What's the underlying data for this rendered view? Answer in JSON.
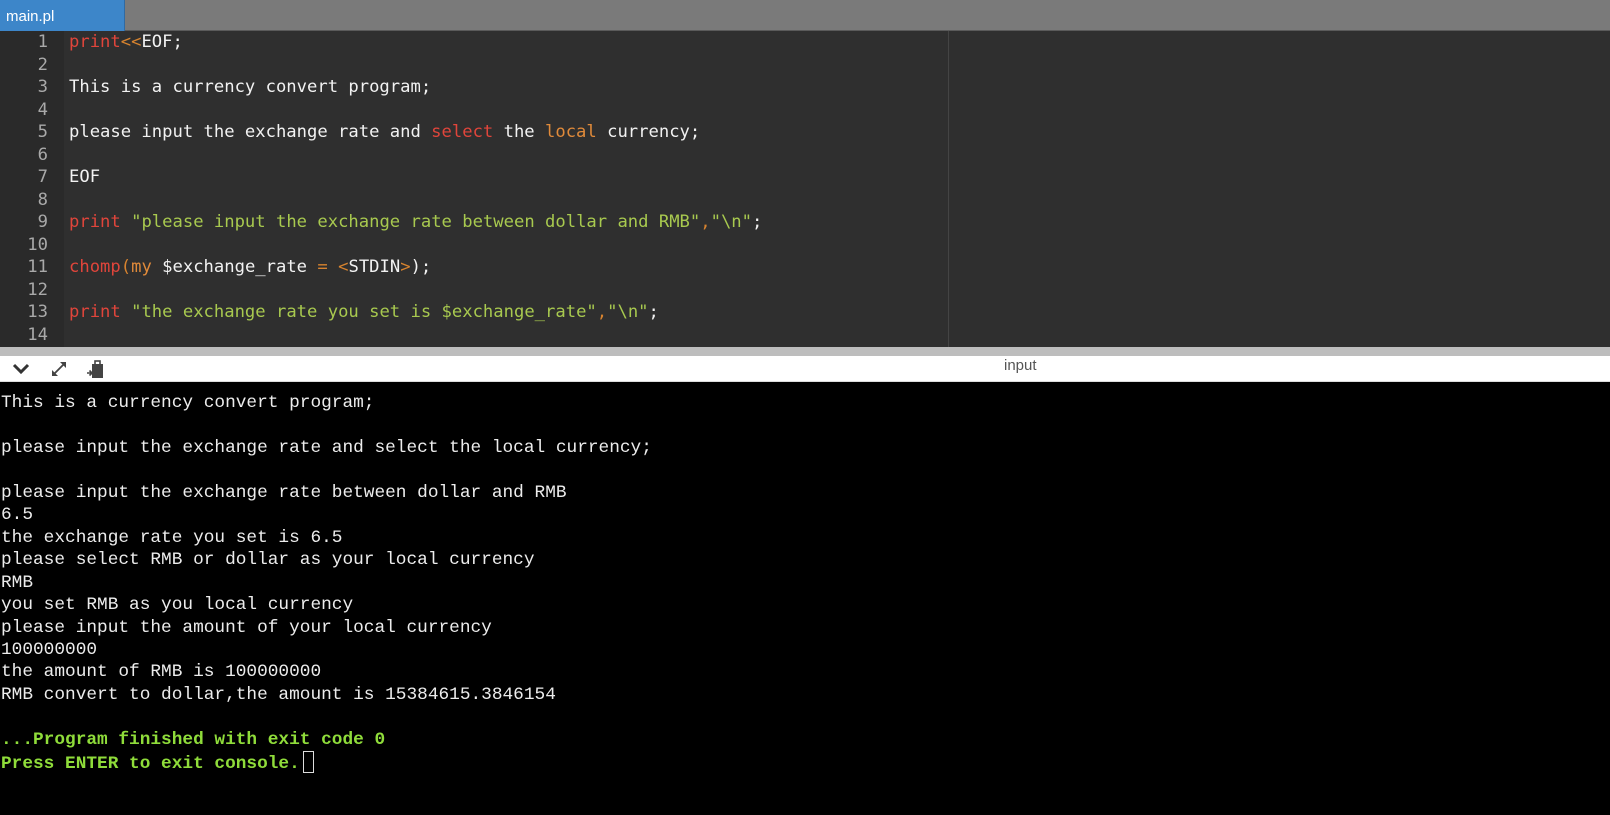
{
  "tab": {
    "label": "main.pl"
  },
  "editor": {
    "lines": [
      {
        "n": "1",
        "segs": [
          [
            "kw",
            "print"
          ],
          [
            "op",
            "<<"
          ],
          [
            "",
            "EOF;"
          ]
        ]
      },
      {
        "n": "2",
        "segs": []
      },
      {
        "n": "3",
        "segs": [
          [
            "",
            "This is a currency convert program;"
          ]
        ]
      },
      {
        "n": "4",
        "segs": []
      },
      {
        "n": "5",
        "segs": [
          [
            "",
            "please input the exchange rate and "
          ],
          [
            "kw",
            "select"
          ],
          [
            "",
            " the "
          ],
          [
            "kw2",
            "local"
          ],
          [
            "",
            " currency;"
          ]
        ]
      },
      {
        "n": "6",
        "segs": []
      },
      {
        "n": "7",
        "segs": [
          [
            "",
            "EOF"
          ]
        ]
      },
      {
        "n": "8",
        "segs": []
      },
      {
        "n": "9",
        "segs": [
          [
            "kw",
            "print"
          ],
          [
            "",
            " "
          ],
          [
            "str",
            "\"please input the exchange rate between dollar and RMB\""
          ],
          [
            "op",
            ","
          ],
          [
            "str",
            "\"\\n\""
          ],
          [
            "",
            ";"
          ]
        ]
      },
      {
        "n": "10",
        "segs": []
      },
      {
        "n": "11",
        "segs": [
          [
            "kw",
            "chomp"
          ],
          [
            "op",
            "("
          ],
          [
            "kw2",
            "my"
          ],
          [
            "",
            " $exchange_rate "
          ],
          [
            "op",
            "="
          ],
          [
            "",
            " "
          ],
          [
            "op",
            "<"
          ],
          [
            "",
            "STDIN"
          ],
          [
            "op",
            ">"
          ],
          [
            "",
            ");"
          ]
        ]
      },
      {
        "n": "12",
        "segs": []
      },
      {
        "n": "13",
        "segs": [
          [
            "kw",
            "print"
          ],
          [
            "",
            " "
          ],
          [
            "str",
            "\"the exchange rate you set is $exchange_rate\""
          ],
          [
            "op",
            ","
          ],
          [
            "str",
            "\"\\n\""
          ],
          [
            "",
            ";"
          ]
        ]
      },
      {
        "n": "14",
        "segs": []
      }
    ]
  },
  "console_header": {
    "title": "input",
    "icons": [
      "chevron-down-icon",
      "expand-icon",
      "clipboard-icon"
    ]
  },
  "console": {
    "lines": [
      "This is a currency convert program;",
      "",
      "please input the exchange rate and select the local currency;",
      "",
      "please input the exchange rate between dollar and RMB",
      "6.5",
      "the exchange rate you set is 6.5",
      "please select RMB or dollar as your local currency",
      "RMB",
      "you set RMB as you local currency",
      "please input the amount of your local currency",
      "100000000",
      "the amount of RMB is 100000000",
      "RMB convert to dollar,the amount is 15384615.3846154",
      ""
    ],
    "finished": "...Program finished with exit code 0",
    "press_enter": "Press ENTER to exit console."
  }
}
